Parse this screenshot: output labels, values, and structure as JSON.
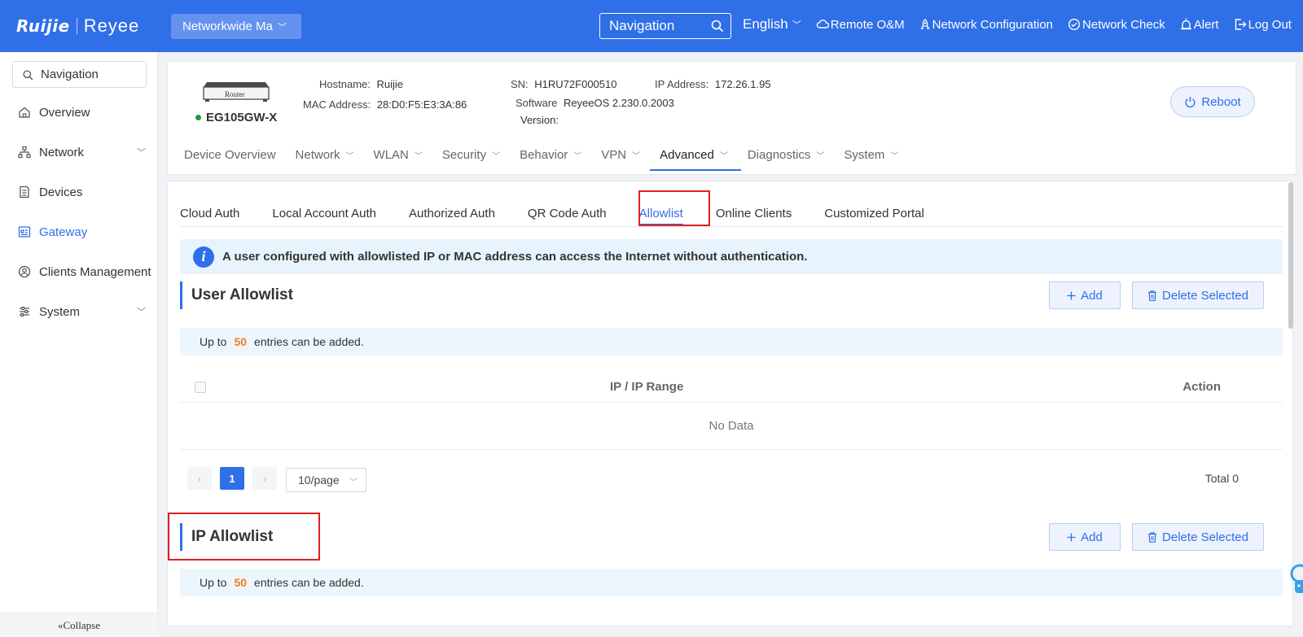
{
  "colors": {
    "primary": "#2f6fe8",
    "highlight": "#e02020",
    "accent_number": "#ee7d16",
    "online": "#1a9e3c"
  },
  "topbar": {
    "logo_brand": "Ruijie",
    "logo_sub": "Reyee",
    "network_selector": "Networkwide Ma",
    "nav_search_placeholder": "Navigation",
    "language": "English",
    "links": {
      "remote": "Remote O&M",
      "netconfig": "Network Configuration",
      "netcheck": "Network Check",
      "alert": "Alert",
      "logout": "Log Out"
    }
  },
  "sidebar": {
    "search_placeholder": "Navigation",
    "items": [
      {
        "label": "Overview",
        "icon": "home-icon"
      },
      {
        "label": "Network",
        "icon": "network-topology-icon"
      },
      {
        "label": "Devices",
        "icon": "devices-icon"
      },
      {
        "label": "Gateway",
        "icon": "gateway-icon"
      },
      {
        "label": "Clients Management",
        "icon": "user-circle-icon"
      },
      {
        "label": "System",
        "icon": "settings-sliders-icon"
      }
    ],
    "collapse_label": "Collapse"
  },
  "device": {
    "image_label": "Router",
    "model": "EG105GW-X",
    "hostname_label": "Hostname:",
    "hostname": "Ruijie",
    "mac_label": "MAC Address:",
    "mac": "28:D0:F5:E3:3A:86",
    "sn_label": "SN:",
    "sn": "H1RU72F000510",
    "software_label_1": "Software",
    "software_label_2": "Version:",
    "software": "ReyeeOS 2.230.0.2003",
    "ip_label": "IP Address:",
    "ip": "172.26.1.95",
    "reboot_label": "Reboot"
  },
  "main_tabs": {
    "device_overview": "Device Overview",
    "network": "Network",
    "wlan": "WLAN",
    "security": "Security",
    "behavior": "Behavior",
    "vpn": "VPN",
    "advanced": "Advanced",
    "diagnostics": "Diagnostics",
    "system": "System"
  },
  "sub_tabs": {
    "cloud_auth": "Cloud Auth",
    "local_account_auth": "Local Account Auth",
    "authorized_auth": "Authorized Auth",
    "qr_code_auth": "QR Code Auth",
    "allowlist": "Allowlist",
    "online_clients": "Online Clients",
    "customized_portal": "Customized Portal"
  },
  "info_banner": "A user configured with allowlisted IP or MAC address can access the Internet without authentication.",
  "user_allowlist": {
    "title": "User Allowlist",
    "add_label": "Add",
    "delete_label": "Delete Selected",
    "limit_prefix": "Up to",
    "limit_value": "50",
    "limit_suffix": "entries can be added.",
    "col_ip": "IP / IP Range",
    "col_action": "Action",
    "empty_text": "No Data",
    "prev": "‹",
    "current_page": "1",
    "next": "›",
    "page_size": "10/page",
    "total": "Total 0"
  },
  "ip_allowlist": {
    "title": "IP Allowlist",
    "add_label": "Add",
    "delete_label": "Delete Selected",
    "limit_prefix": "Up to",
    "limit_value": "50",
    "limit_suffix": "entries can be added."
  }
}
